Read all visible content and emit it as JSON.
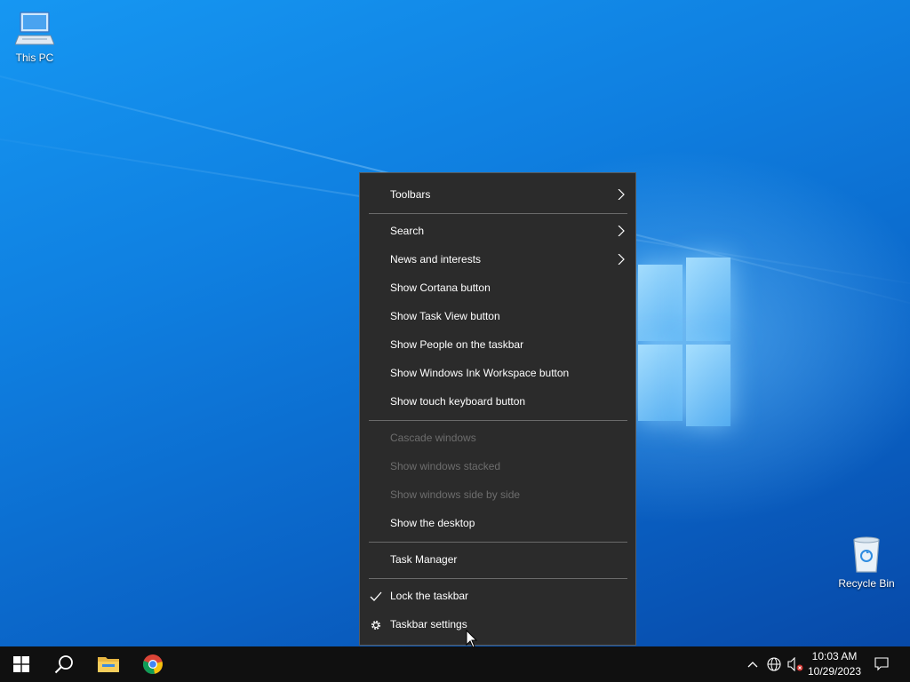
{
  "desktop": {
    "icons": [
      {
        "label": "This PC",
        "icon": "computer-icon"
      },
      {
        "label": "Recycle Bin",
        "icon": "recycle-bin-icon"
      }
    ]
  },
  "context_menu": {
    "items": [
      {
        "label": "Toolbars",
        "submenu": true,
        "enabled": true
      },
      {
        "label": "Search",
        "submenu": true,
        "enabled": true
      },
      {
        "label": "News and interests",
        "submenu": true,
        "enabled": true
      },
      {
        "label": "Show Cortana button",
        "enabled": true
      },
      {
        "label": "Show Task View button",
        "enabled": true
      },
      {
        "label": "Show People on the taskbar",
        "enabled": true
      },
      {
        "label": "Show Windows Ink Workspace button",
        "enabled": true
      },
      {
        "label": "Show touch keyboard button",
        "enabled": true
      },
      {
        "label": "Cascade windows",
        "enabled": false
      },
      {
        "label": "Show windows stacked",
        "enabled": false
      },
      {
        "label": "Show windows side by side",
        "enabled": false
      },
      {
        "label": "Show the desktop",
        "enabled": true
      },
      {
        "label": "Task Manager",
        "enabled": true
      },
      {
        "label": "Lock the taskbar",
        "checked": true,
        "enabled": true
      },
      {
        "label": "Taskbar settings",
        "icon": "gear-icon",
        "enabled": true
      }
    ]
  },
  "taskbar": {
    "buttons": [
      {
        "icon": "windows-start-icon"
      },
      {
        "icon": "search-icon"
      },
      {
        "icon": "file-explorer-icon"
      },
      {
        "icon": "chrome-icon"
      }
    ],
    "tray": {
      "icons": [
        "chevron-up-icon",
        "network-icon",
        "volume-muted-icon"
      ],
      "time": "10:03 AM",
      "date": "10/29/2023"
    }
  },
  "colors": {
    "menu_bg": "#2b2b2b",
    "menu_text": "#ffffff",
    "menu_disabled_text": "#6d6d6d",
    "taskbar_bg": "#101010",
    "desktop_accent": "#0f7fe0"
  }
}
